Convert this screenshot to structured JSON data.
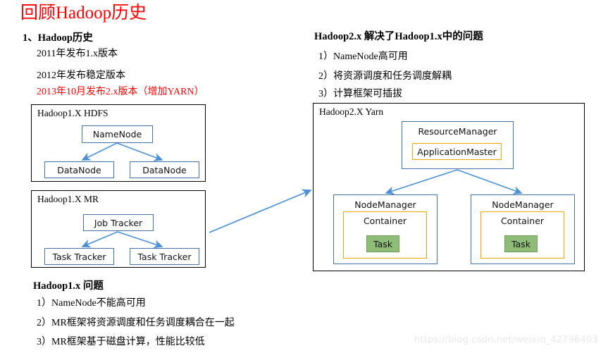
{
  "title": "回顾Hadoop历史",
  "left_column": {
    "heading": "1、Hadoop历史",
    "items": [
      {
        "text": "2011年发布1.x版本",
        "color": "#000000"
      },
      {
        "text": "2012年发布稳定版本",
        "color": "#000000"
      },
      {
        "text": "2013年10月发布2.x版本（增加YARN）",
        "color": "#ff0000"
      }
    ]
  },
  "right_column": {
    "heading": "Hadoop2.x 解决了Hadoop1.x中的问题",
    "items": [
      "1）NameNode高可用",
      "2）将资源调度和任务调度解耦",
      "3）计算框架可插拔"
    ]
  },
  "hdfs_diagram": {
    "label": "Hadoop1.X HDFS",
    "master": "NameNode",
    "workers": [
      "DataNode",
      "DataNode"
    ]
  },
  "mr_diagram": {
    "label": "Hadoop1.X MR",
    "master": "Job Tracker",
    "workers": [
      "Task Tracker",
      "Task Tracker"
    ]
  },
  "yarn_diagram": {
    "label": "Hadoop2.X Yarn",
    "resource_manager": "ResourceManager",
    "application_master": "ApplicationMaster",
    "node_managers": [
      {
        "title": "NodeManager",
        "container": "Container",
        "task": "Task"
      },
      {
        "title": "NodeManager",
        "container": "Container",
        "task": "Task"
      }
    ]
  },
  "problems": {
    "heading": "Hadoop1.x 问题",
    "items": [
      "1）NameNode不能高可用",
      "2）MR框架将资源调度和任务调度耦合在一起",
      "3）MR框架基于磁盘计算，性能比较低"
    ]
  },
  "watermark": "https://blog.csdn.net/weixin_42796403",
  "colors": {
    "title_red": "#ff0000",
    "node_blue": "#4472a8",
    "arrow_blue": "#4a90d9",
    "container_orange": "#f0a500",
    "task_green": "#8fbc77",
    "outer_black": "#000000"
  }
}
